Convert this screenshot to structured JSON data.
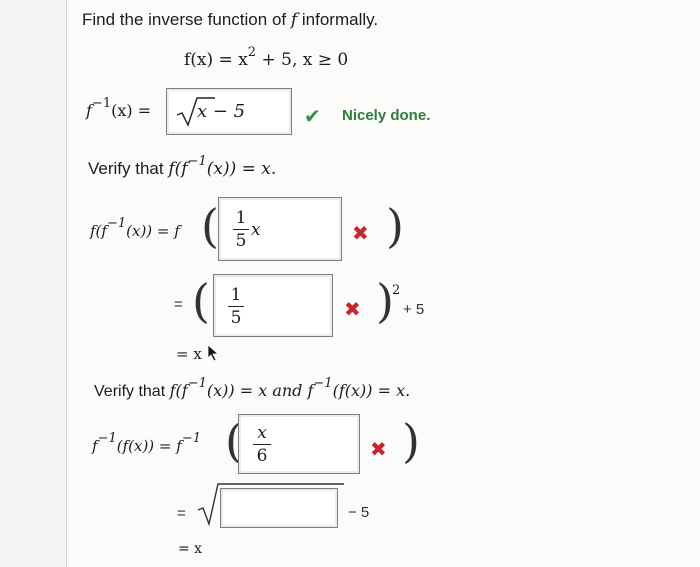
{
  "prompt": "Find the inverse function of",
  "prompt_var": "f",
  "prompt_tail": "informally.",
  "function": {
    "lhs": "f(x) = x",
    "exp": "2",
    "rhs": "+ 5, x ≥ 0"
  },
  "inverse": {
    "label": "f",
    "label_exp": "−1",
    "label_tail": "(x) =",
    "answer_radicand": "x − 5",
    "feedback": "Nicely done."
  },
  "verify1": {
    "text": "Verify that",
    "expr": "f(f",
    "expr_exp": "−1",
    "expr_tail": "(x)) = x.",
    "row1_lhs": "f(f",
    "row1_lhs_exp": "−1",
    "row1_lhs_tail": "(x)) = f",
    "row1_frac_num": "1",
    "row1_frac_den": "5",
    "row1_frac_var": "x",
    "row2_eq": "=",
    "row2_frac_num": "1",
    "row2_frac_den": "5",
    "row2_exp": "2",
    "row2_tail": "+ 5",
    "row3": "= x"
  },
  "verify2": {
    "text": "Verify that",
    "expr": "f(f",
    "expr_exp": "−1",
    "expr_mid": "(x)) = x and f",
    "expr_exp2": "−1",
    "expr_tail": "(f(x)) = x.",
    "row1_lhs": "f",
    "row1_lhs_exp": "−1",
    "row1_lhs_tail": "(f(x)) = f",
    "row1_lhs_exp2": "−1",
    "row1_frac_num": "x",
    "row1_frac_den": "6",
    "row2_eq": "=",
    "row2_tail": "− 5",
    "row3": "= x"
  },
  "marks": {
    "check": "✔",
    "wrong": "✖"
  },
  "icons": {
    "check": "check-icon",
    "wrong": "x-mark-icon",
    "cursor": "mouse-pointer-icon"
  },
  "colors": {
    "correct": "#2e7d3b",
    "wrong": "#c8252c"
  }
}
